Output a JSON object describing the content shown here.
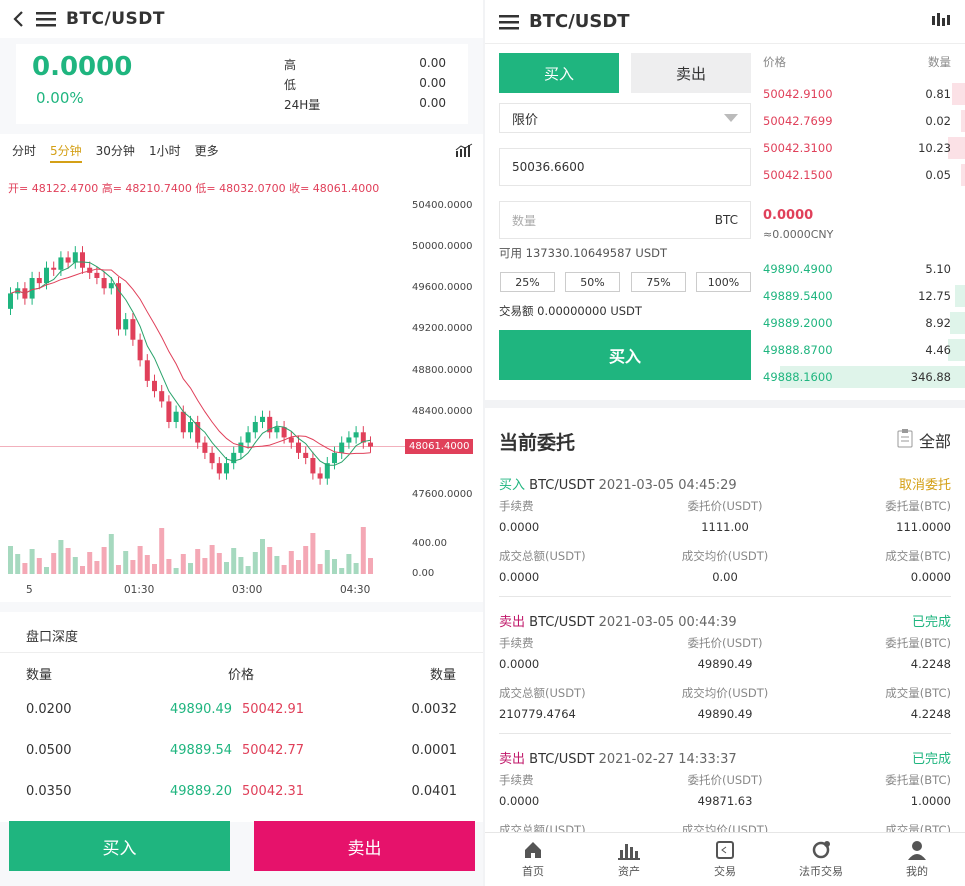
{
  "left": {
    "pair": "BTC/USDT",
    "price": "0.0000",
    "change": "0.00%",
    "stats": [
      {
        "label": "高",
        "value": "0.00"
      },
      {
        "label": "低",
        "value": "0.00"
      },
      {
        "label": "24H量",
        "value": "0.00"
      }
    ],
    "tabs": [
      "分时",
      "5分钟",
      "30分钟",
      "1小时",
      "更多"
    ],
    "active_tab": "5分钟",
    "ohlc": "开= 48122.4700  高= 48210.7400  低= 48032.0700  收= 48061.4000",
    "y_ticks": [
      "50400.0000",
      "50000.0000",
      "49600.0000",
      "49200.0000",
      "48800.0000",
      "48400.0000",
      "47600.0000"
    ],
    "last_price": "48061.4000",
    "vol_ticks": [
      "400.00",
      "0.00"
    ],
    "x_ticks": [
      "5",
      "01:30",
      "03:00",
      "04:30"
    ],
    "depth": {
      "title": "盘口深度",
      "headers": [
        "数量",
        "价格",
        "数量"
      ],
      "rows": [
        [
          "0.0200",
          "49890.49",
          "50042.91",
          "0.0032"
        ],
        [
          "0.0500",
          "49889.54",
          "50042.77",
          "0.0001"
        ],
        [
          "0.0350",
          "49889.20",
          "50042.31",
          "0.0401"
        ]
      ]
    },
    "buy": "买入",
    "sell": "卖出"
  },
  "right": {
    "pair": "BTC/USDT",
    "tab_buy": "买入",
    "tab_sell": "卖出",
    "order_type": "限价",
    "price_value": "50036.6600",
    "qty_placeholder": "数量",
    "qty_unit": "BTC",
    "available": "可用 137330.10649587 USDT",
    "percents": [
      "25%",
      "50%",
      "75%",
      "100%"
    ],
    "amount": "交易额 0.00000000 USDT",
    "submit": "买入",
    "ob_headers": [
      "价格",
      "数量"
    ],
    "asks": [
      [
        "50042.9100",
        "0.81",
        0.06
      ],
      [
        "50042.7699",
        "0.02",
        0.02
      ],
      [
        "50042.3100",
        "10.23",
        0.08
      ],
      [
        "50042.1500",
        "0.05",
        0.02
      ]
    ],
    "mid_price": "0.0000",
    "mid_cny": "≈0.0000CNY",
    "bids": [
      [
        "49890.4900",
        "5.10",
        0.0
      ],
      [
        "49889.5400",
        "12.75",
        0.05
      ],
      [
        "49889.2000",
        "8.92",
        0.07
      ],
      [
        "49888.8700",
        "4.46",
        0.08
      ],
      [
        "49888.1600",
        "346.88",
        0.88
      ]
    ],
    "orders_title": "当前委托",
    "all": "全部",
    "orders": [
      {
        "side": "买入",
        "pair": "BTC/USDT",
        "time": "2021-03-05 04:45:29",
        "status": "取消委托",
        "fee": "0.0000",
        "price": "1111.00",
        "amount": "111.0000",
        "total": "0.0000",
        "avg": "0.00",
        "filled": "0.0000"
      },
      {
        "side": "卖出",
        "pair": "BTC/USDT",
        "time": "2021-03-05 00:44:39",
        "status": "已完成",
        "fee": "0.0000",
        "price": "49890.49",
        "amount": "4.2248",
        "total": "210779.4764",
        "avg": "49890.49",
        "filled": "4.2248"
      },
      {
        "side": "卖出",
        "pair": "BTC/USDT",
        "time": "2021-02-27 14:33:37",
        "status": "已完成",
        "fee": "0.0000",
        "price": "49871.63",
        "amount": "1.0000",
        "total": "",
        "avg": "",
        "filled": ""
      }
    ],
    "labels": {
      "fee": "手续费",
      "price": "委托价(USDT)",
      "amount": "委托量(BTC)",
      "total": "成交总额(USDT)",
      "avg": "成交均价(USDT)",
      "filled": "成交量(BTC)"
    },
    "nav": [
      "首页",
      "资产",
      "交易",
      "法币交易",
      "我的"
    ]
  },
  "colors": {
    "green": "#1fb57f",
    "red": "#e0405a",
    "gold": "#d4a017",
    "sell_button": "#e6126b"
  }
}
